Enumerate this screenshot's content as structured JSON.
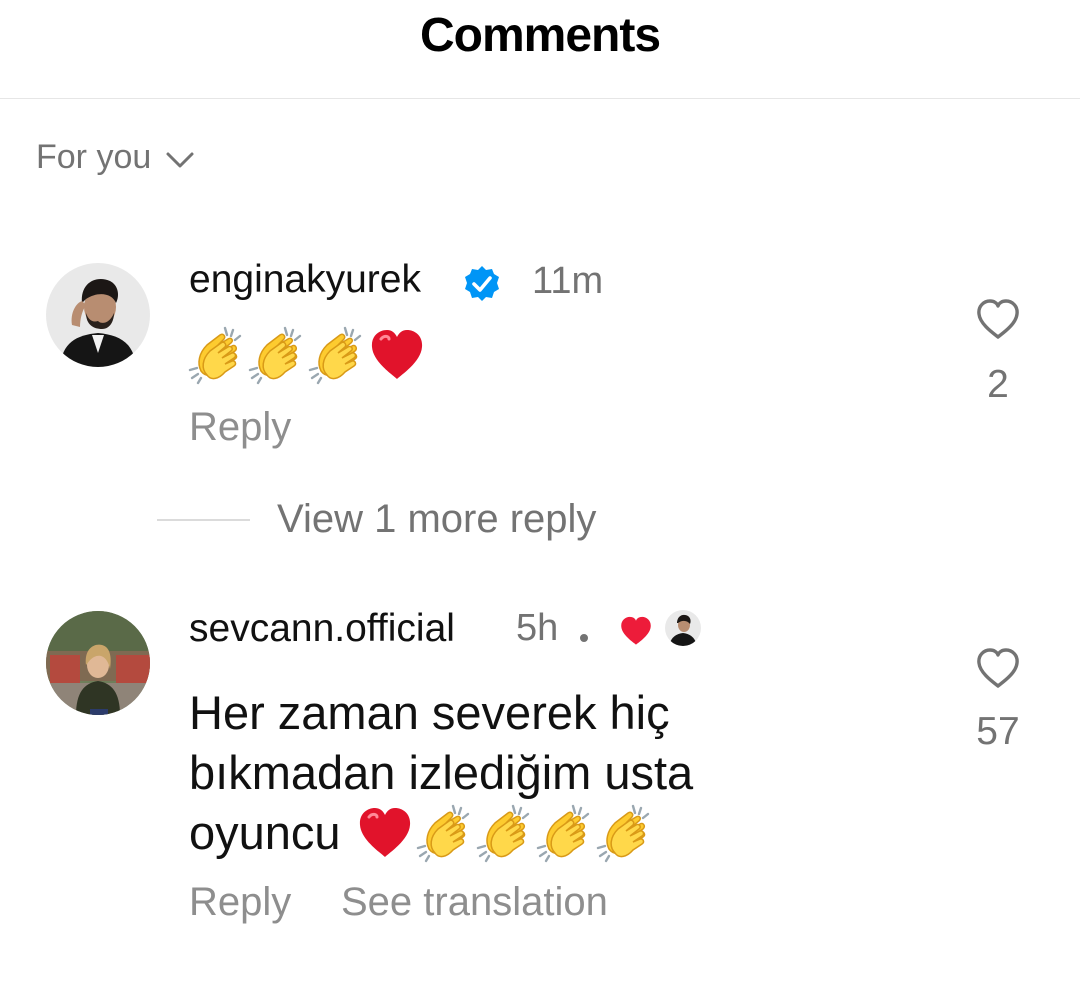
{
  "header": {
    "title": "Comments"
  },
  "sort": {
    "label": "For you"
  },
  "comments": [
    {
      "username": "enginakyurek",
      "verified": true,
      "time": "11m",
      "emojis": [
        "clapping-hands",
        "clapping-hands",
        "clapping-hands",
        "red-heart"
      ],
      "likes": "2",
      "reply_label": "Reply",
      "view_replies_label": "View 1 more reply"
    },
    {
      "username": "sevcann.official",
      "time": "5h",
      "creator_liked": true,
      "text_line1": "Her zaman severek hiç",
      "text_line2": "bıkmadan izlediğim usta",
      "text_line3": "oyuncu",
      "emojis": [
        "red-heart",
        "clapping-hands",
        "clapping-hands",
        "clapping-hands",
        "clapping-hands"
      ],
      "likes": "57",
      "reply_label": "Reply",
      "translate_label": "See translation"
    }
  ],
  "colors": {
    "verified": "#0095f6",
    "heart": "#ed1c3a",
    "muted": "#8e8e8e"
  }
}
